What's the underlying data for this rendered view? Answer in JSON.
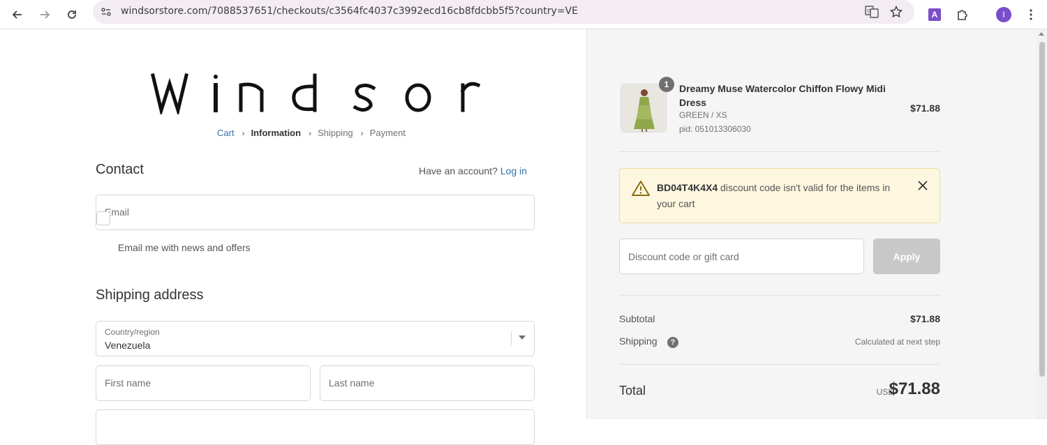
{
  "browser": {
    "url": "windsorstore.com/7088537651/checkouts/c3564fc4037c3992ecd16cb8fdcbb5f5?country=VE",
    "profile_initial": "I",
    "extension_letter": "A"
  },
  "brand": {
    "logo_text": "WINDSOR"
  },
  "breadcrumb": [
    "Cart",
    "Information",
    "Shipping",
    "Payment"
  ],
  "contact": {
    "heading": "Contact",
    "have_account": "Have an account?",
    "login": "Log in",
    "email_placeholder": "Email",
    "news_label": "Email me with news and offers"
  },
  "shipping": {
    "heading": "Shipping address",
    "country_label": "Country/region",
    "country_value": "Venezuela",
    "first_name_placeholder": "First name",
    "last_name_placeholder": "Last name"
  },
  "cart": {
    "quantity": "1",
    "product_name": "Dreamy Muse Watercolor Chiffon Flowy Midi Dress",
    "variant": "GREEN / XS",
    "pid": "pid: 051013306030",
    "price": "$71.88"
  },
  "notice": {
    "code": "BD04T4K4X4",
    "message": " discount code isn't valid for the items in your cart"
  },
  "discount": {
    "placeholder": "Discount code or gift card",
    "apply": "Apply"
  },
  "summary": {
    "subtotal_label": "Subtotal",
    "subtotal_value": "$71.88",
    "shipping_label": "Shipping",
    "shipping_value": "Calculated at next step",
    "total_label": "Total",
    "currency": "USD",
    "total_value": "$71.88"
  },
  "colors": {
    "link": "#2e6ea6",
    "notice_bg": "#fdf7e0",
    "profile": "#7b4ec9",
    "apply_disabled": "#c8c8c8"
  }
}
